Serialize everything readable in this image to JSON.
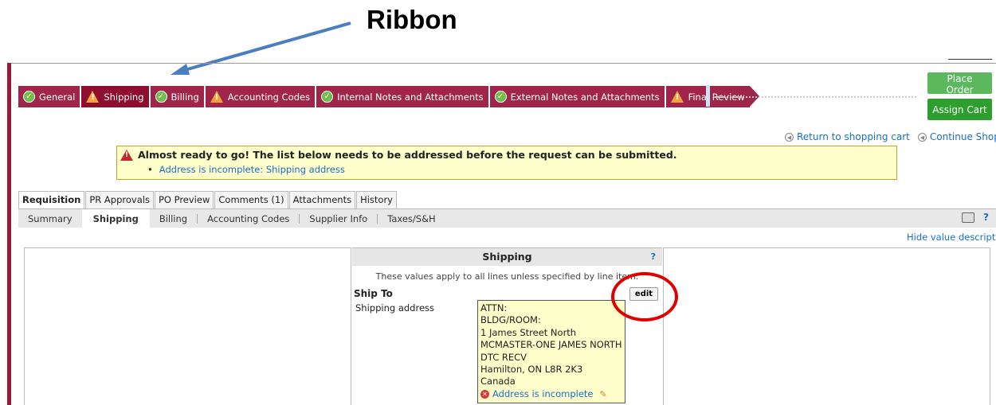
{
  "annotation": {
    "label": "Ribbon"
  },
  "ribbon": {
    "steps": [
      {
        "label": "General",
        "status": "done"
      },
      {
        "label": "Shipping",
        "status": "warn"
      },
      {
        "label": "Billing",
        "status": "done"
      },
      {
        "label": "Accounting Codes",
        "status": "warn"
      },
      {
        "label": "Internal Notes and Attachments",
        "status": "done"
      },
      {
        "label": "External Notes and Attachments",
        "status": "done"
      },
      {
        "label": "Final Review",
        "status": "warn"
      }
    ]
  },
  "actions": {
    "place_order": "Place Order",
    "assign_cart": "Assign Cart"
  },
  "links": {
    "return_cart": "Return to shopping cart",
    "continue_shopping": "Continue Shopping",
    "hide_desc": "Hide value descriptions"
  },
  "notice": {
    "heading": "Almost ready to go! The list below needs to be addressed before the request can be submitted.",
    "items": [
      "Address is incomplete: Shipping address"
    ]
  },
  "tabs": [
    "Requisition",
    "PR Approvals",
    "PO Preview",
    "Comments (1)",
    "Attachments",
    "History"
  ],
  "subtabs": [
    "Summary",
    "Shipping",
    "Billing",
    "Accounting Codes",
    "Supplier Info",
    "Taxes/S&H"
  ],
  "shipping": {
    "title": "Shipping",
    "help": "?",
    "note": "These values apply to all lines unless specified by line item.",
    "ship_to": "Ship To",
    "edit": "edit",
    "address_label": "Shipping address",
    "address_lines": [
      "ATTN:",
      "BLDG/ROOM:",
      "1 James Street North",
      "MCMASTER-ONE JAMES NORTH",
      "DTC RECV",
      "Hamilton, ON L8R 2K3",
      "Canada"
    ],
    "address_warning": "Address is incomplete"
  },
  "colors": {
    "ribbon": "#a0254a",
    "accent_link": "#1a6fc9",
    "place_order": "#5cb85c",
    "assign_cart": "#2e9e2e",
    "highlight": "#e00000"
  }
}
